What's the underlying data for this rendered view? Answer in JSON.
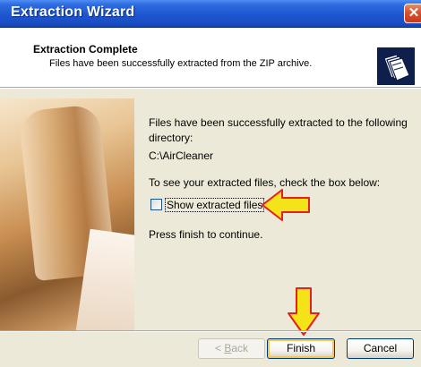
{
  "window": {
    "title": "Extraction Wizard",
    "close_icon": "close-icon"
  },
  "header": {
    "title": "Extraction Complete",
    "subtitle": "Files have been successfully extracted from the ZIP archive.",
    "icon": "zip-folder-icon"
  },
  "body": {
    "line1": "Files have been successfully extracted to the following",
    "line2": "directory:",
    "directory": "C:\\AirCleaner",
    "instruction": "To see your extracted files, check the box below:",
    "checkbox_label": "Show extracted files",
    "checkbox_checked": false,
    "finish_hint": "Press finish to continue."
  },
  "annotations": {
    "arrow_color": "#f5e31a",
    "arrow_outline": "#e3211c"
  },
  "buttons": {
    "back_prefix": "< ",
    "back_access": "B",
    "back_rest": "ack",
    "finish": "Finish",
    "cancel": "Cancel"
  }
}
